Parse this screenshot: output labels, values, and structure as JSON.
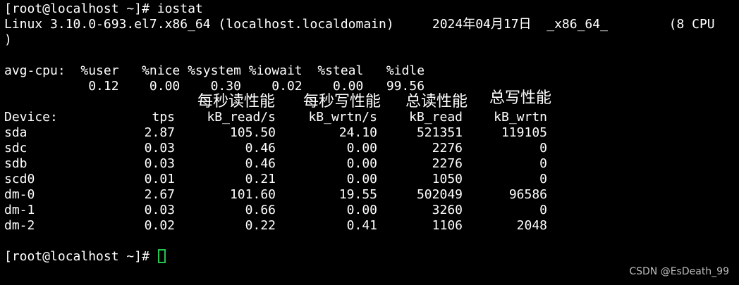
{
  "terminal": {
    "cmd_line": "[root@localhost ~]# iostat",
    "sys_line": "Linux 3.10.0-693.el7.x86_64 (localhost.localdomain)     2024年04月17日  _x86_64_        (8 CPU",
    "sys_line_wrap": ")",
    "cpu_header": "avg-cpu:  %user   %nice %system %iowait  %steal   %idle",
    "cpu_values": "           0.12    0.00    0.30    0.02    0.00   99.56",
    "prompt_end": "[root@localhost ~]# ",
    "cursor_color": "#23c552"
  },
  "annotations": {
    "read_per_sec": "每秒读性能",
    "write_per_sec": "每秒写性能",
    "total_read": "总读性能",
    "total_write": "总写性能"
  },
  "device_table": {
    "headers": [
      "Device:",
      "tps",
      "kB_read/s",
      "kB_wrtn/s",
      "kB_read",
      "kB_wrtn"
    ],
    "rows": [
      [
        "sda",
        "2.87",
        "105.50",
        "24.10",
        "521351",
        "119105"
      ],
      [
        "sdc",
        "0.03",
        "0.46",
        "0.00",
        "2276",
        "0"
      ],
      [
        "sdb",
        "0.03",
        "0.46",
        "0.00",
        "2276",
        "0"
      ],
      [
        "scd0",
        "0.01",
        "0.21",
        "0.00",
        "1050",
        "0"
      ],
      [
        "dm-0",
        "2.67",
        "101.60",
        "19.55",
        "502049",
        "96586"
      ],
      [
        "dm-1",
        "0.03",
        "0.66",
        "0.00",
        "3260",
        "0"
      ],
      [
        "dm-2",
        "0.02",
        "0.22",
        "0.41",
        "1106",
        "2048"
      ]
    ]
  },
  "watermark": "CSDN @EsDeath_99"
}
